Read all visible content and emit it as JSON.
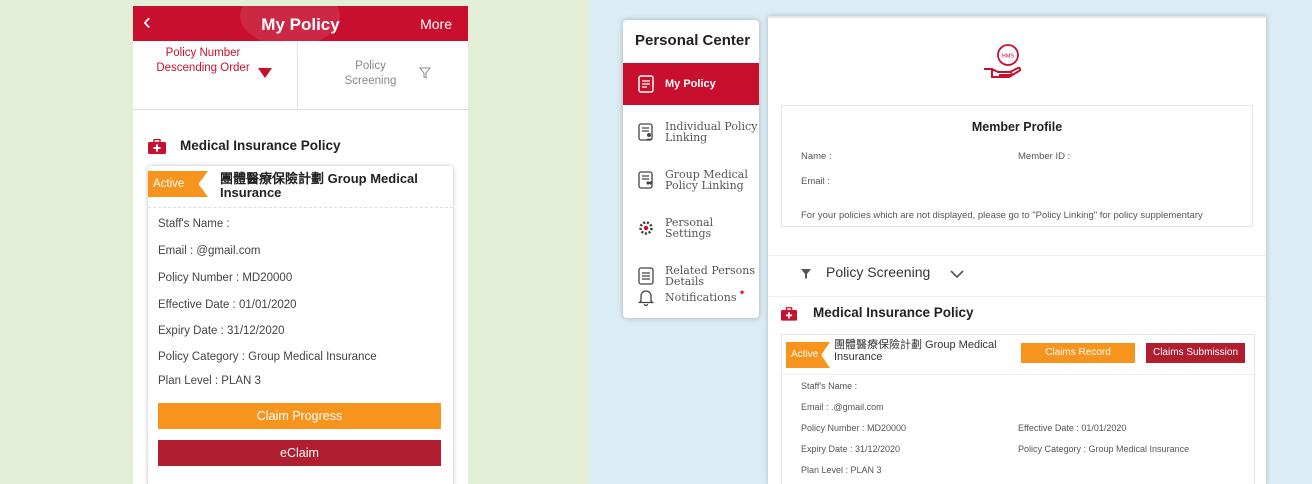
{
  "mobile": {
    "header": {
      "back_icon": "‹",
      "title": "My Policy",
      "more": "More"
    },
    "sort": {
      "label": "Policy Number Descending Order"
    },
    "screening": {
      "label": "Policy Screening"
    },
    "section_title": "Medical Insurance Policy",
    "card": {
      "status": "Active",
      "title": "團體醫療保險計劃 Group Medical Insurance",
      "rows": [
        "Staff's Name :",
        "Email :              @gmail.com",
        "Policy Number : MD20000",
        "Effective Date : 01/01/2020",
        "Expiry Date : 31/12/2020",
        "Policy Category : Group Medical Insurance",
        "Plan Level :  PLAN 3"
      ],
      "claim_progress": "Claim Progress",
      "eclaim": "eClaim"
    }
  },
  "desktop": {
    "sidebar": {
      "title": "Personal Center",
      "items": [
        {
          "label": "My Policy"
        },
        {
          "label": "Individual Policy Linking"
        },
        {
          "label": "Group Medical Policy Linking"
        },
        {
          "label": "Personal Settings"
        },
        {
          "label": "Related Persons Details"
        },
        {
          "label": "Notifications"
        }
      ],
      "notification_dot": "•"
    },
    "logo_text": "HMS",
    "profile": {
      "title": "Member Profile",
      "name_label": "Name :",
      "member_id_label": "Member ID :",
      "email_label": "Email :",
      "note": "For your policies which are not displayed, please go to \"Policy Linking\" for policy supplementary"
    },
    "screening_label": "Policy Screening",
    "section_title": "Medical Insurance Policy",
    "card": {
      "status": "Active",
      "title": "團體醫療保險計劃 Group Medical Insurance",
      "claims_record": "Claims Record",
      "claims_submission": "Claims Submission",
      "staff_name": "Staff's Name :",
      "email": "Email :              .@gmail.com",
      "policy_number": "Policy Number : MD20000",
      "effective_date": "Effective Date : 01/01/2020",
      "expiry_date": "Expiry Date : 31/12/2020",
      "policy_category": "Policy Category : Group Medical Insurance",
      "plan_level": "Plan Level : PLAN 3"
    }
  },
  "colors": {
    "brand_red": "#c8102e",
    "orange": "#f7941d",
    "dark_red": "#b01e2f"
  }
}
